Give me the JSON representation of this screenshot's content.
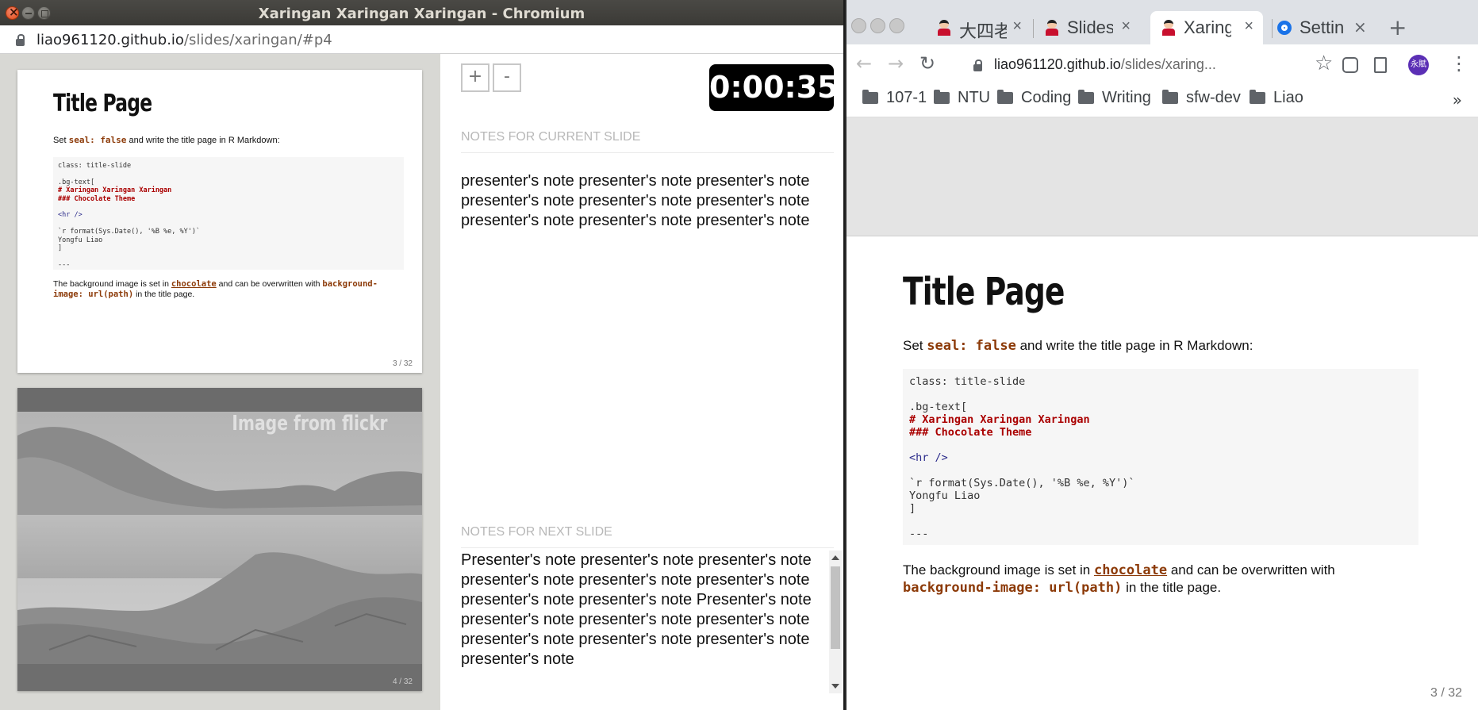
{
  "left_window": {
    "title": "Xaringan Xaringan Xaringan - Chromium",
    "url_host": "liao961120.github.io",
    "url_path": "/slides/xaringan/#p4",
    "current_slide": {
      "title": "Title Page",
      "p1_pre": "Set ",
      "p1_code": "seal: false",
      "p1_post": " and write the title page in R Markdown:",
      "code_lines": {
        "l1": "class: title-slide",
        "l2": ".bg-text[",
        "l3": "# Xaringan Xaringan Xaringan",
        "l4": "### Chocolate Theme",
        "l5": "<hr />",
        "l6": "`r format(Sys.Date(), '%B %e, %Y')`",
        "l7": "Yongfu Liao",
        "l8": "]",
        "l9": "---"
      },
      "p2_pre": "The background image is set in ",
      "p2_link": "chocolate",
      "p2_mid": " and can be overwritten with ",
      "p2_code": "background-image: url(path)",
      "p2_post": " in the title page.",
      "slide_number": "3 / 32"
    },
    "next_slide": {
      "caption": "Image from flickr",
      "slide_number": "4 / 32"
    },
    "zoom_plus": "+",
    "zoom_minus": "-",
    "timer": "0:00:35",
    "notes_current_heading": "NOTES FOR CURRENT SLIDE",
    "notes_current_text": "presenter's note presenter's note presenter's note presenter's note presenter's note presenter's note presenter's note presenter's note presenter's note",
    "notes_next_heading": "NOTES FOR NEXT SLIDE",
    "notes_next_text": "Presenter's note presenter's note presenter's note presenter's note presenter's note presenter's note presenter's note presenter's note Presenter's note presenter's note presenter's note presenter's note presenter's note presenter's note presenter's note presenter's note"
  },
  "right_window": {
    "tabs": [
      {
        "label": "大四老"
      },
      {
        "label": "Slides"
      },
      {
        "label": "Xaring"
      },
      {
        "label": "Settin"
      }
    ],
    "new_tab": "+",
    "url_host": "liao961120.github.io",
    "url_path": "/slides/xaring...",
    "avatar_text": "永賦",
    "bookmarks": [
      "107-1",
      "NTU",
      "Coding",
      "Writing",
      "sfw-dev",
      "Liao"
    ],
    "bookmarks_overflow": "»"
  },
  "colors": {
    "code_accent": "#8c3a08",
    "timer_bg": "#000000",
    "titlebar": "#3b3a36"
  }
}
